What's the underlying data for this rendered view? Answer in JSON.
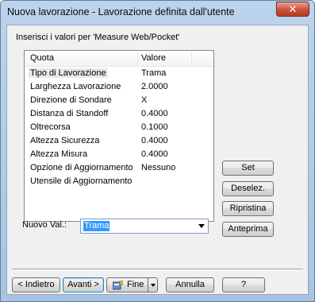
{
  "window": {
    "title": "Nuova lavorazione - Lavorazione definita dall'utente",
    "close_glyph": "✕"
  },
  "prompt": "Inserisci i valori per 'Measure Web/Pocket'",
  "list": {
    "headers": [
      "Quota",
      "Valore"
    ],
    "rows": [
      {
        "name": "Tipo di Lavorazione",
        "value": "Trama"
      },
      {
        "name": "Larghezza Lavorazione",
        "value": "2.0000"
      },
      {
        "name": "Direzione di Sondare",
        "value": "X"
      },
      {
        "name": "Distanza di Standoff",
        "value": "0.4000"
      },
      {
        "name": "Oltrecorsa",
        "value": "0.1000"
      },
      {
        "name": "Altezza Sicurezza",
        "value": "0.4000"
      },
      {
        "name": "Altezza Misura",
        "value": "0.4000"
      },
      {
        "name": "Opzione di Aggiornamento",
        "value": "Nessuno"
      },
      {
        "name": "Utensile di Aggiornamento",
        "value": ""
      }
    ]
  },
  "side_buttons": {
    "set": "Set",
    "deselect": "Deselez.",
    "restore": "Ripristina",
    "preview": "Anteprima"
  },
  "new_value": {
    "label": "Nuovo Val.:",
    "value": "Trama"
  },
  "footer": {
    "back": "< Indietro",
    "next": "Avanti >",
    "finish": "Fine",
    "cancel": "Annulla",
    "help": "?"
  },
  "icons": {
    "finish_icon": "flag-icon",
    "close_icon": "close-icon"
  }
}
